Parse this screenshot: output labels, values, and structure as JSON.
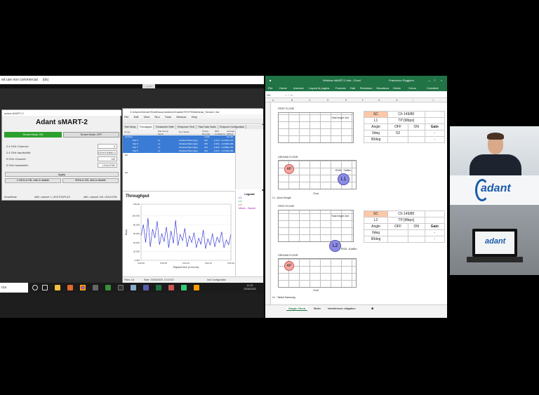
{
  "desktop": {
    "topbar_text": "ed use non commercial     (dx)",
    "tab_text": "—  ×"
  },
  "smart_app": {
    "window_title": "adant sMART-2",
    "heading": "Adant sMART-2",
    "smart_on_label": "Smart Mode ON",
    "smart_off_label": "Smart Mode OFF",
    "rows": [
      {
        "label": "2.4 GHz Channel:",
        "value": "6"
      },
      {
        "label": "2.4 GHz bandwidth:",
        "value": "LEGHT40BELO"
      },
      {
        "label": "5 GHz Channel:",
        "value": "149"
      },
      {
        "label": "5 GHz bandwidth:",
        "value": "LEACHT80"
      }
    ],
    "apply_label": "Apply",
    "disable_24_label": "2.4GHz is ON, click to disable",
    "disable_5_label": "5GHz is ON, click to disable",
    "status_left": "SmartMode",
    "status_mid": "wifi0: channel 1, LEGHT40PLUS",
    "status_right": "wifi1: channel 149, LEACHT80"
  },
  "chariot": {
    "window_title": "C:\\Users\\Server\\Test\\Documents\\IxChariot\\TESTS\\Webinar_Smart-2.tst",
    "menu": [
      "File",
      "Edit",
      "View",
      "Run",
      "Tools",
      "Window",
      "Help"
    ],
    "tabs": [
      "Test Setup",
      "Throughput",
      "Transaction Rate",
      "Response Time",
      "Raw Data Totals",
      "Endpoint Configuration"
    ],
    "active_tab": "Throughput",
    "columns": [
      "Group",
      "Pair Group Name",
      "Run Status",
      "Timing Records Completed",
      "95% Confidence Interval",
      "Average (Mbps)"
    ],
    "all_pairs_row": {
      "label": "All Pairs",
      "records": "2,000",
      "avg": "52.196"
    },
    "pairs": [
      {
        "name": "Pair 5",
        "group": "L1",
        "status": "Finished Warning(s)",
        "records": "320",
        "ci": "-0.373 : +0.373",
        "avg": "13.176"
      },
      {
        "name": "Pair 6",
        "group": "L1",
        "status": "Finished Warning(s)",
        "records": "326",
        "ci": "-0.331 : +0.331",
        "avg": "13.296"
      },
      {
        "name": "Pair 7",
        "group": "L1",
        "status": "Finished Warning(s)",
        "records": "310",
        "ci": "-0.365 : +0.365",
        "avg": "12.370"
      },
      {
        "name": "Pair 8",
        "group": "L1",
        "status": "Finished Warning(s)",
        "records": "324",
        "ci": "-0.372 : +0.372",
        "avg": "13.289"
      }
    ],
    "groups_collapsed": [
      "L2",
      "L3"
    ],
    "chart_title": "Throughput",
    "legend_title": "Legend",
    "legend_items": [
      "L1",
      "L2",
      "L3",
      "Mesh - Backh"
    ],
    "status_left": "Pairs: 16",
    "status_mid": "Start: 23/06/2020, 10:19:20",
    "status_right": "Ixia Configuration"
  },
  "chart_data": {
    "type": "line",
    "title": "Throughput",
    "xlabel": "Elapsed time (h:mm:ss)",
    "ylabel": "Mbps",
    "ylim": [
      0,
      126
    ],
    "yticks": [
      0,
      20,
      40,
      60,
      80,
      100,
      126
    ],
    "ytick_labels": [
      "0.000",
      "20.000",
      "40.000",
      "60.000",
      "80.000",
      "100.000",
      "126.00"
    ],
    "xticks": [
      "0:00:00",
      "0:00:05",
      "0:00:10",
      "0:00:15",
      "0:00:20"
    ],
    "series": [
      {
        "name": "L1",
        "color": "#1f23d6",
        "values": [
          55,
          80,
          40,
          95,
          30,
          70,
          50,
          88,
          35,
          60,
          42,
          75,
          28,
          66,
          38,
          90,
          33,
          58,
          44,
          72,
          30,
          55,
          40,
          62,
          28,
          50,
          36,
          68,
          26,
          48,
          34,
          60,
          30,
          52,
          40,
          64,
          28,
          46,
          35,
          58
        ]
      }
    ]
  },
  "taskbar": {
    "search_text": "rca",
    "time": "10:19",
    "date": "23/06/2020"
  },
  "excel": {
    "title": "Webinar sMART-2.xlsx - Excel",
    "user": "Francesco Ruggiero",
    "ribbon": [
      "File",
      "Home",
      "Inserisci",
      "Layout di pagina",
      "Formule",
      "Dati",
      "Revisione",
      "Visualizza",
      "Guida",
      "Cerca",
      "Condividi"
    ],
    "name_box": "H4",
    "columns": [
      "A",
      "B",
      "C",
      "D",
      "E",
      "F",
      "G",
      "H",
      "I",
      "J"
    ],
    "first_floor_label": "FIRST FLOOR",
    "ground_floor_label": "GROUND FLOOR",
    "total_height_label": "Total height 4mt",
    "width_label": "21mt",
    "ap_label": "AP",
    "section1": {
      "client": "L1",
      "rssi": "RSSI: -73dBm",
      "caption": "L1 - Asus Dongle",
      "table": {
        "sc": "SC",
        "channel": "Ch 149/80",
        "client": "L1",
        "tp": "TP [Mbps]",
        "angle": "Angle",
        "off": "OFF",
        "on": "ON",
        "gain": "Gain",
        "rows": [
          {
            "angle": "0deg",
            "off": "53",
            "on": "",
            "gain": "-"
          },
          {
            "angle": "90deg",
            "off": "",
            "on": "",
            "gain": "-"
          }
        ]
      }
    },
    "section2": {
      "client": "L2",
      "rssi": "RSSI: -81dBm",
      "caption": "L2 - TabA4 Samsung",
      "table": {
        "sc": "SC",
        "channel": "Ch 149/80",
        "client": "L2",
        "tp": "TP [Mbps]",
        "angle": "Angle",
        "off": "OFF",
        "on": "ON",
        "gain": "Gain",
        "rows": [
          {
            "angle": "0deg",
            "off": "",
            "on": "",
            "gain": "-"
          },
          {
            "angle": "90deg",
            "off": "",
            "on": "",
            "gain": "-"
          }
        ]
      }
    },
    "sheet_tabs": [
      "Single Client",
      "Mesh",
      "Interference mitigation"
    ],
    "active_sheet": "Single Client"
  },
  "webcam": {
    "brand_logo_text": "adant"
  }
}
